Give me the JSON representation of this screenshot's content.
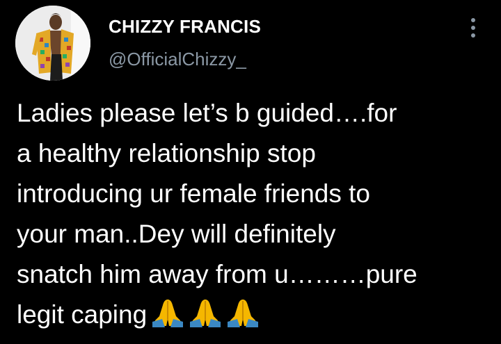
{
  "author": {
    "display_name": "CHIZZY FRANCIS",
    "handle": "@OfficialChizzy_",
    "avatar_icon": "profile-photo"
  },
  "menu": {
    "icon": "more-vertical-icon"
  },
  "tweet": {
    "lines": [
      "Ladies please let’s b guided….for",
      "a healthy relationship stop",
      "introducing ur female friends to",
      "your man..Dey will definitely",
      "snatch him away from u………pure",
      "legit caping"
    ],
    "emoji": [
      "🙏",
      "🙏",
      "🙏"
    ],
    "emoji_icon": "folded-hands-icon"
  },
  "colors": {
    "background": "#000000",
    "text_primary": "#ffffff",
    "text_secondary": "#8b98a5",
    "emoji_skin": "#f5b700",
    "emoji_sleeve": "#3b88c3"
  }
}
